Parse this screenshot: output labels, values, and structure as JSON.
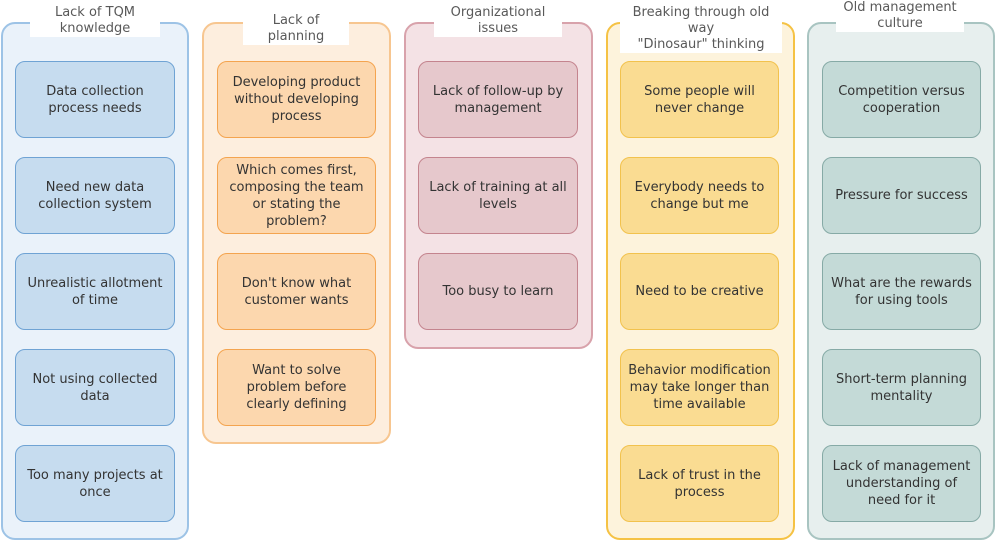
{
  "columns": [
    {
      "title": "Lack of TQM knowledge",
      "title_lines": [
        "Lack of TQM",
        "knowledge"
      ],
      "color": "#9dc3e6",
      "items": [
        "Data collection process needs",
        "Need new data collection system",
        "Unrealistic allotment of time",
        "Not using collected data",
        "Too many projects at once"
      ]
    },
    {
      "title": "Lack of planning",
      "title_lines": [
        "Lack of planning"
      ],
      "color": "#f7c690",
      "items": [
        "Developing product without developing process",
        "Which comes first, composing the team or stating the problem?",
        "Don't know what customer wants",
        "Want to solve problem before clearly defining"
      ]
    },
    {
      "title": "Organizational issues",
      "title_lines": [
        "Organizational",
        "issues"
      ],
      "color": "#d8a2ab",
      "items": [
        "Lack of follow-up by management",
        "Lack of training at all levels",
        "Too busy to learn"
      ]
    },
    {
      "title": "Breaking through old way \"Dinosaur\" thinking",
      "title_lines": [
        "Breaking through old way",
        "\"Dinosaur\" thinking"
      ],
      "color": "#f5c244",
      "items": [
        "Some people will never change",
        "Everybody needs to change but me",
        "Need to be creative",
        "Behavior modification may take longer than time available",
        "Lack of trust in the process"
      ]
    },
    {
      "title": "Old management culture",
      "title_lines": [
        "Old management",
        "culture"
      ],
      "color": "#a8c4c1",
      "items": [
        "Competition versus cooperation",
        "Pressure for success",
        "What are the rewards for using tools",
        "Short-term planning mentality",
        "Lack of management understanding of need for it"
      ]
    }
  ]
}
